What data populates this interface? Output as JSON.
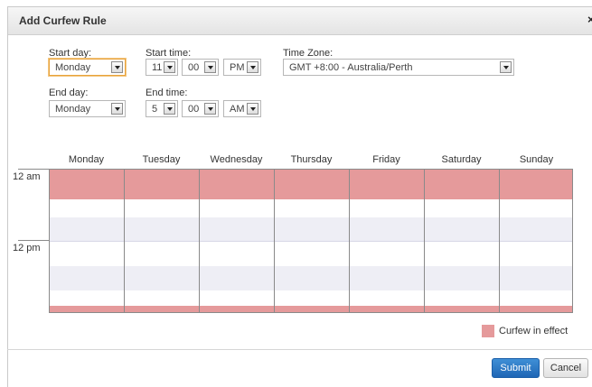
{
  "dialog": {
    "title": "Add Curfew Rule",
    "close_glyph": "×"
  },
  "form": {
    "start_day": {
      "label": "Start day:",
      "value": "Monday"
    },
    "end_day": {
      "label": "End day:",
      "value": "Monday"
    },
    "start_time": {
      "label": "Start time:",
      "hour": "11",
      "minute": "00",
      "ampm": "PM"
    },
    "end_time": {
      "label": "End time:",
      "hour": "5",
      "minute": "00",
      "ampm": "AM"
    },
    "time_zone": {
      "label": "Time Zone:",
      "value": "GMT +8:00 - Australia/Perth"
    }
  },
  "schedule": {
    "days": [
      "Monday",
      "Tuesday",
      "Wednesday",
      "Thursday",
      "Friday",
      "Saturday",
      "Sunday"
    ],
    "time_labels": [
      "12 am",
      "12 pm"
    ],
    "curfew_color": "#e59a9b",
    "alt_row_color": "#eeeef5",
    "curfew_periods": [
      {
        "from_hour": 0,
        "to_hour": 5
      },
      {
        "from_hour": 23,
        "to_hour": 24
      }
    ]
  },
  "legend": {
    "label": "Curfew in effect",
    "color": "#e59a9b"
  },
  "buttons": {
    "submit": "Submit",
    "cancel": "Cancel"
  }
}
